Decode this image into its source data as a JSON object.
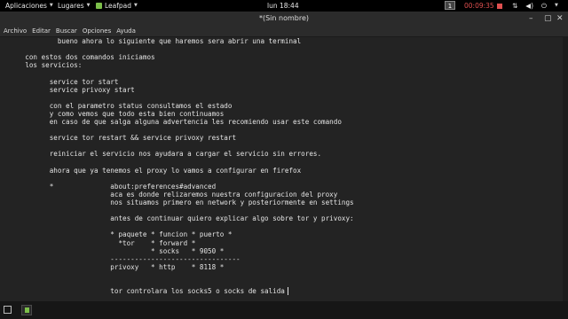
{
  "panel": {
    "apps_label": "Aplicaciones",
    "places_label": "Lugares",
    "app_label": "Leafpad",
    "clock": "lun 18:44",
    "workspace": "1",
    "timer": "00:09:35"
  },
  "window": {
    "title": "*(Sin nombre)"
  },
  "menu": {
    "items": [
      "Archivo",
      "Editar",
      "Buscar",
      "Opciones",
      "Ayuda"
    ]
  },
  "editor": {
    "lines": [
      "            bueno ahora lo siguiente que haremos sera abrir una terminal",
      "",
      "    con estos dos comandos iniciamos",
      "    los servicios:",
      "",
      "          service tor start",
      "          service privoxy start",
      "",
      "          con el parametro status consultamos el estado",
      "          y como vemos que todo esta bien continuamos",
      "          en caso de que salga alguna advertencia les recomiendo usar este comando",
      "",
      "          service tor restart && service privoxy restart",
      "",
      "          reiniciar el servicio nos ayudara a cargar el servicio sin errores.",
      "",
      "          ahora que ya tenemos el proxy lo vamos a configurar en firefox",
      "",
      "          *              about:preferences#advanced",
      "                         aca es donde relizaremos nuestra configuracion del proxy",
      "                         nos situamos primero en network y posteriormente en settings",
      "",
      "                         antes de continuar quiero explicar algo sobre tor y privoxy:",
      "",
      "                         * paquete * funcion * puerto *",
      "                           *tor    * forward *",
      "                                   * socks   * 9050 *",
      "                         --------------------------------",
      "                         privoxy   * http    * 8118 *",
      "",
      "",
      "                         tor controlara los socks5 o socks de salida"
    ]
  }
}
